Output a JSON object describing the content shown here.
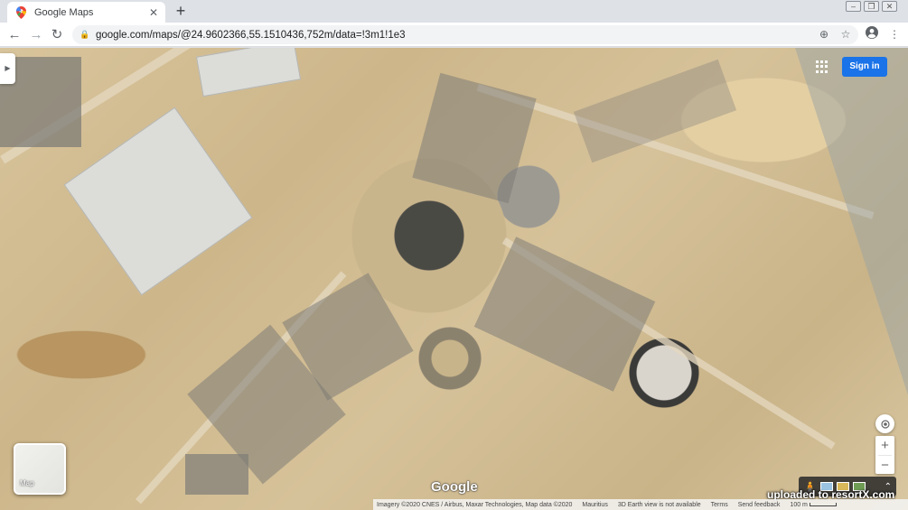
{
  "browser": {
    "tab_title": "Google Maps",
    "new_tab_label": "+",
    "url": "google.com/maps/@24.9602366,55.1510436,752m/data=!3m1!1e3",
    "icons": [
      "maps-favicon",
      "close-icon",
      "back-icon",
      "forward-icon",
      "reload-icon",
      "lock-icon",
      "location-icon",
      "star-icon",
      "profile-icon",
      "menu-icon",
      "minimize-icon",
      "restore-icon",
      "window-close-icon"
    ]
  },
  "maps": {
    "sign_in_label": "Sign in",
    "map_type_label": "Map",
    "zoom_in_label": "+",
    "zoom_out_label": "−",
    "google_logo_text": "Google",
    "accent_color": "#1a73e8",
    "footer": {
      "imagery": "Imagery ©2020 CNES / Airbus, Maxar Technologies, Map data ©2020",
      "country": "Mauritius",
      "earth_view": "3D Earth view is not available",
      "terms": "Terms",
      "feedback": "Send feedback",
      "scale": "100 m"
    }
  },
  "watermark": "uploaded to resortX.com"
}
